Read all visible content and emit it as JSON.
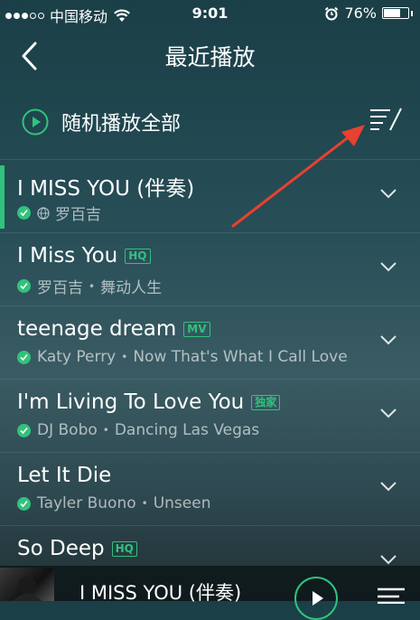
{
  "status_bar": {
    "carrier": "中国移动",
    "time": "9:01",
    "battery": "76%",
    "battery_level": 0.76
  },
  "nav": {
    "title": "最近播放"
  },
  "shuffle": {
    "label": "随机播放全部"
  },
  "songs": [
    {
      "title": "I MISS YOU (伴奏)",
      "badge": "",
      "artist": "罗百吉",
      "album": "",
      "active": true
    },
    {
      "title": "I Miss You",
      "badge": "HQ",
      "artist": "罗百吉",
      "album": "舞动人生",
      "active": false
    },
    {
      "title": "teenage dream",
      "badge": "MV",
      "artist": "Katy Perry",
      "album": "Now That's What I Call Love",
      "active": false
    },
    {
      "title": "I'm Living To Love You",
      "badge": "独家",
      "artist": "DJ Bobo",
      "album": "Dancing Las Vegas",
      "active": false
    },
    {
      "title": "Let It Die",
      "badge": "",
      "artist": "Tayler Buono",
      "album": "Unseen",
      "active": false
    },
    {
      "title": "So Deep",
      "badge": "HQ",
      "artist": "",
      "album": "",
      "active": false
    }
  ],
  "player": {
    "title": "I MISS YOU (伴奏)"
  },
  "colors": {
    "accent": "#31c27c",
    "annotation_arrow": "#e8412f"
  }
}
